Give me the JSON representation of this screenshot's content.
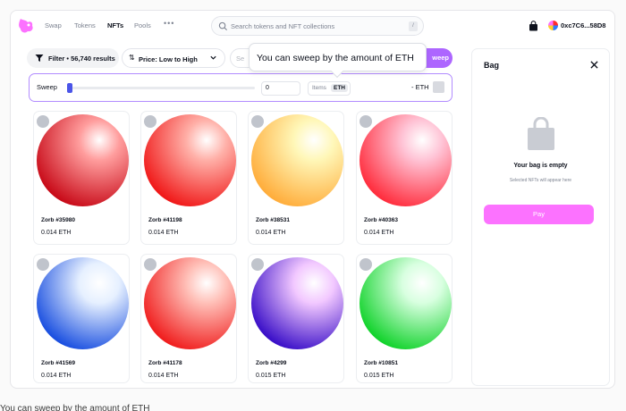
{
  "nav": {
    "links": [
      "Swap",
      "Tokens",
      "NFTs",
      "Pools"
    ],
    "active": "NFTs",
    "more": "•••",
    "search_placeholder": "Search tokens and NFT collections",
    "search_shortcut": "/",
    "wallet_address": "0xc7C6...58D8"
  },
  "toolbar": {
    "filter_label": "Filter • 56,740 results",
    "sort_icon": "sort-arrows-icon",
    "sort_label": "Price: Low to High",
    "search_placeholder": "Se",
    "sweep_label": "weep"
  },
  "tooltip": {
    "text": "You can sweep by the amount of ETH"
  },
  "sweep": {
    "label": "Sweep",
    "slider_value": 0,
    "input_value": "0",
    "toggle_items": "Items",
    "toggle_eth": "ETH",
    "eth_label": "- ETH"
  },
  "cards": [
    {
      "name": "Zorb #35980",
      "price": "0.014 ETH",
      "color_light": "#ff9d9d",
      "color_dark": "#c80a18"
    },
    {
      "name": "Zorb #41198",
      "price": "0.014 ETH",
      "color_light": "#ffb0a8",
      "color_dark": "#f01818"
    },
    {
      "name": "Zorb #38531",
      "price": "0.014 ETH",
      "color_light": "#fff7b8",
      "color_dark": "#ffad3b"
    },
    {
      "name": "Zorb #40363",
      "price": "0.014 ETH",
      "color_light": "#ffc4d6",
      "color_dark": "#ff2d3d"
    },
    {
      "name": "Zorb #41569",
      "price": "0.014 ETH",
      "color_light": "#e6f0ff",
      "color_dark": "#1a4fe0"
    },
    {
      "name": "Zorb #41178",
      "price": "0.014 ETH",
      "color_light": "#ffc0b8",
      "color_dark": "#f01e1e"
    },
    {
      "name": "Zorb #4299",
      "price": "0.015 ETH",
      "color_light": "#f2c8ff",
      "color_dark": "#3a0fc8"
    },
    {
      "name": "Zorb #10851",
      "price": "0.015 ETH",
      "color_light": "#d8ffe0",
      "color_dark": "#12d32c"
    }
  ],
  "bag": {
    "title": "Bag",
    "empty_text": "Your bag is empty",
    "sub_text": "Selected NFTs will appear here",
    "pay_label": "Pay"
  },
  "caption": "You can sweep by the amount of ETH"
}
